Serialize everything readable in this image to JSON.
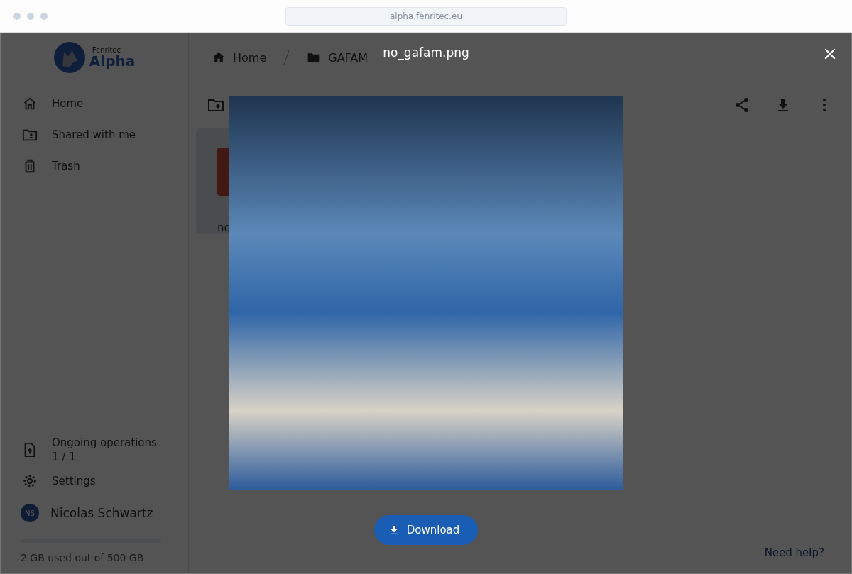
{
  "browser": {
    "url": "alpha.fenritec.eu"
  },
  "brand": {
    "over": "Fenritec",
    "name": "Alpha"
  },
  "sidebar": {
    "items": [
      {
        "label": "Home",
        "kind": "home"
      },
      {
        "label": "Shared with me",
        "kind": "shared"
      },
      {
        "label": "Trash",
        "kind": "trash"
      }
    ],
    "operations": {
      "label": "Ongoing operations",
      "count": "1 / 1"
    },
    "settings": "Settings",
    "user": {
      "initials": "NS",
      "name": "Nicolas Schwartz"
    },
    "storage": {
      "level": 0.004,
      "text": "2 GB used out of 500 GB"
    }
  },
  "breadcrumb": [
    {
      "label": "Home",
      "kind": "home"
    },
    {
      "label": "GAFAM",
      "kind": "folder"
    }
  ],
  "files": [
    {
      "name": "no"
    }
  ],
  "help": "Need help?",
  "viewer": {
    "title": "no_gafam.png",
    "download": "Download"
  }
}
